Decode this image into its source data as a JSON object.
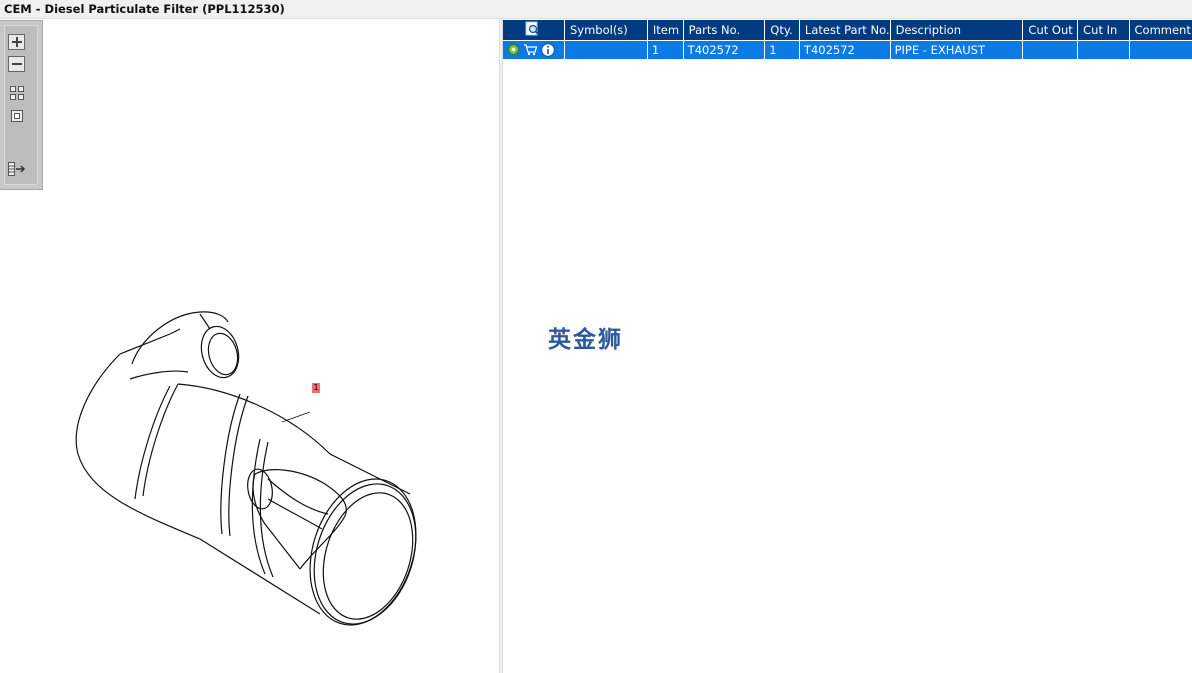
{
  "window": {
    "title": "CEM - Diesel Particulate Filter (PPL112530)"
  },
  "toolbar": {
    "icons": [
      "zoom-in-icon",
      "zoom-out-icon",
      "fit-all-icon",
      "fit-window-icon",
      "toggle-panel-icon"
    ]
  },
  "drawing": {
    "callout_label": "1"
  },
  "parts_table": {
    "columns": [
      "Symbol(s)",
      "Item",
      "Parts No.",
      "Qty.",
      "Latest Part No.",
      "Description",
      "Cut Out",
      "Cut In",
      "Comment"
    ],
    "rows": [
      {
        "symbols": "",
        "item": "1",
        "parts_no": "T402572",
        "qty": "1",
        "latest_part_no": "T402572",
        "description": "PIPE - EXHAUST",
        "cut_out": "",
        "cut_in": "",
        "comment": ""
      }
    ],
    "header_color": "#003b82",
    "selected_row_color": "#0a7ae6"
  },
  "watermark": {
    "text": "英金狮"
  }
}
